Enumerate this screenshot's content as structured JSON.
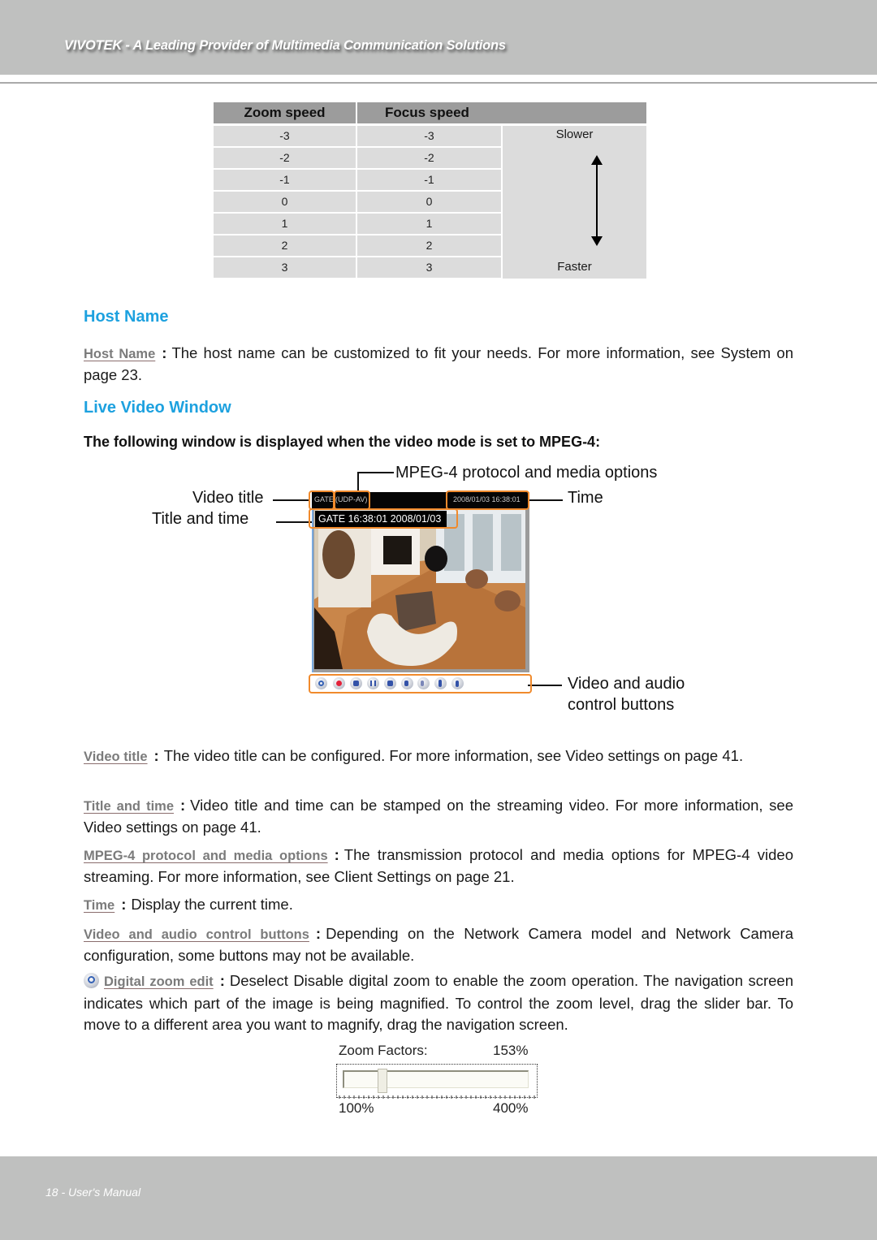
{
  "header": {
    "title": "VIVOTEK - A Leading Provider of Multimedia Communication Solutions"
  },
  "speed_table": {
    "headers": [
      "Zoom speed",
      "Focus speed"
    ],
    "rows": [
      {
        "zoom": "-3",
        "focus": "-3"
      },
      {
        "zoom": "-2",
        "focus": "-2"
      },
      {
        "zoom": "-1",
        "focus": "-1"
      },
      {
        "zoom": "0",
        "focus": "0"
      },
      {
        "zoom": "1",
        "focus": "1"
      },
      {
        "zoom": "2",
        "focus": "2"
      },
      {
        "zoom": "3",
        "focus": "3"
      }
    ],
    "top_label": "Slower",
    "bottom_label": "Faster"
  },
  "host_name": {
    "heading": "Host Name",
    "term": "Host Name",
    "text": "The host name can be customized to fit your needs. For more information, see System on page 23."
  },
  "live_video": {
    "heading": "Live Video Window",
    "intro": "The following window is displayed when the video mode is set to MPEG-4:",
    "callouts": {
      "protocol": "MPEG-4 protocol and media options",
      "video_title": "Video title",
      "time": "Time",
      "title_and_time": "Title and time",
      "controls_line1": "Video and audio",
      "controls_line2": "control buttons"
    },
    "window": {
      "title": "GATE",
      "protocol": "(UDP-AV)",
      "time": "2008/01/03 16:38:01",
      "stamp": "GATE 16:38:01 2008/01/03",
      "control_buttons": [
        "digital-zoom",
        "record",
        "snapshot",
        "pause",
        "stop",
        "volume",
        "mute",
        "talk",
        "mic-volume"
      ]
    },
    "descriptions": [
      {
        "term": "Video title",
        "text": "The video title can be configured. For more information, see Video settings on page 41."
      },
      {
        "term": "Title and time",
        "text": "Video title and time can be stamped on the streaming video. For more information, see Video settings on page 41."
      },
      {
        "term": "MPEG-4 protocol and media options",
        "text": "The transmission protocol and media options for MPEG-4 video streaming. For more information, see Client Settings on page 21."
      },
      {
        "term": "Time",
        "text": "Display the current time."
      },
      {
        "term": "Video and audio control buttons",
        "text": "Depending on the Network Camera model and Network Camera configuration, some buttons may not be available."
      },
      {
        "term": "Digital zoom edit",
        "text": "Deselect Disable digital zoom to enable the zoom operation. The navigation screen indicates which part of the image is being magnified. To control the zoom level, drag the slider bar. To move to a different area you want to magnify, drag the navigation screen."
      }
    ]
  },
  "zoom_factor": {
    "label": "Zoom Factors:",
    "value": "153%",
    "min_label": "100%",
    "max_label": "400%",
    "current_percent": 153,
    "min_percent": 100,
    "max_percent": 400
  },
  "footer": {
    "text": "18 - User's Manual"
  }
}
